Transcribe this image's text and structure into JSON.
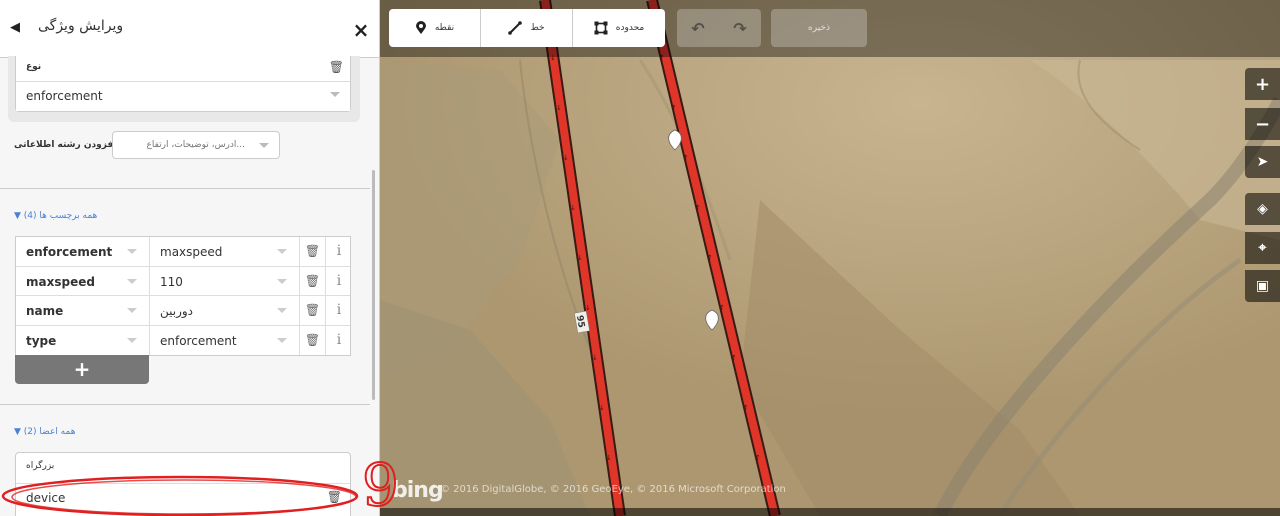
{
  "sidebar": {
    "title": "ویرایش ویژگی",
    "close_label": "×",
    "back_label": "◀",
    "type_field": {
      "label": "نوع",
      "value": "enforcement"
    },
    "add_field": {
      "label": ":افزودن رشته اطلاعاتی",
      "placeholder": "...آدرس، توضیحات، ارتفاع"
    },
    "tags_section": {
      "toggle_label": "▼ (همه برچسب ها (4",
      "rows": [
        {
          "key": "enforcement",
          "value": "maxspeed"
        },
        {
          "key": "maxspeed",
          "value": "110"
        },
        {
          "key": "name",
          "value": "دوربین"
        },
        {
          "key": "type",
          "value": "enforcement"
        }
      ],
      "add_label": "+",
      "info_label": "i",
      "delete_icon": "trash-icon"
    },
    "members_section": {
      "toggle_label": "▼ (همه اعضا (2",
      "member": {
        "role": "بزرگراه",
        "value": "device"
      }
    }
  },
  "toolbar": {
    "point_label": "نقطه",
    "line_label": "خط",
    "area_label": "محدوده",
    "undo_label": "↶",
    "redo_label": "↷",
    "save_label": "ذخیره"
  },
  "map": {
    "road_ref": "95",
    "attribution": "© 2016 DigitalGlobe, © 2016 GeoEye, © 2016 Microsoft Corporation",
    "logo": "bing",
    "annotation_number": "9",
    "controls": {
      "zoom_in": "+",
      "zoom_out": "−",
      "geolocate": "➤",
      "layers": "◈",
      "data": "⌖",
      "help": "▣"
    }
  },
  "colors": {
    "road_red": "#e0362a",
    "annotation_red": "#e02020",
    "link_blue": "#4a80d5",
    "terrain": "#b8a57f"
  }
}
